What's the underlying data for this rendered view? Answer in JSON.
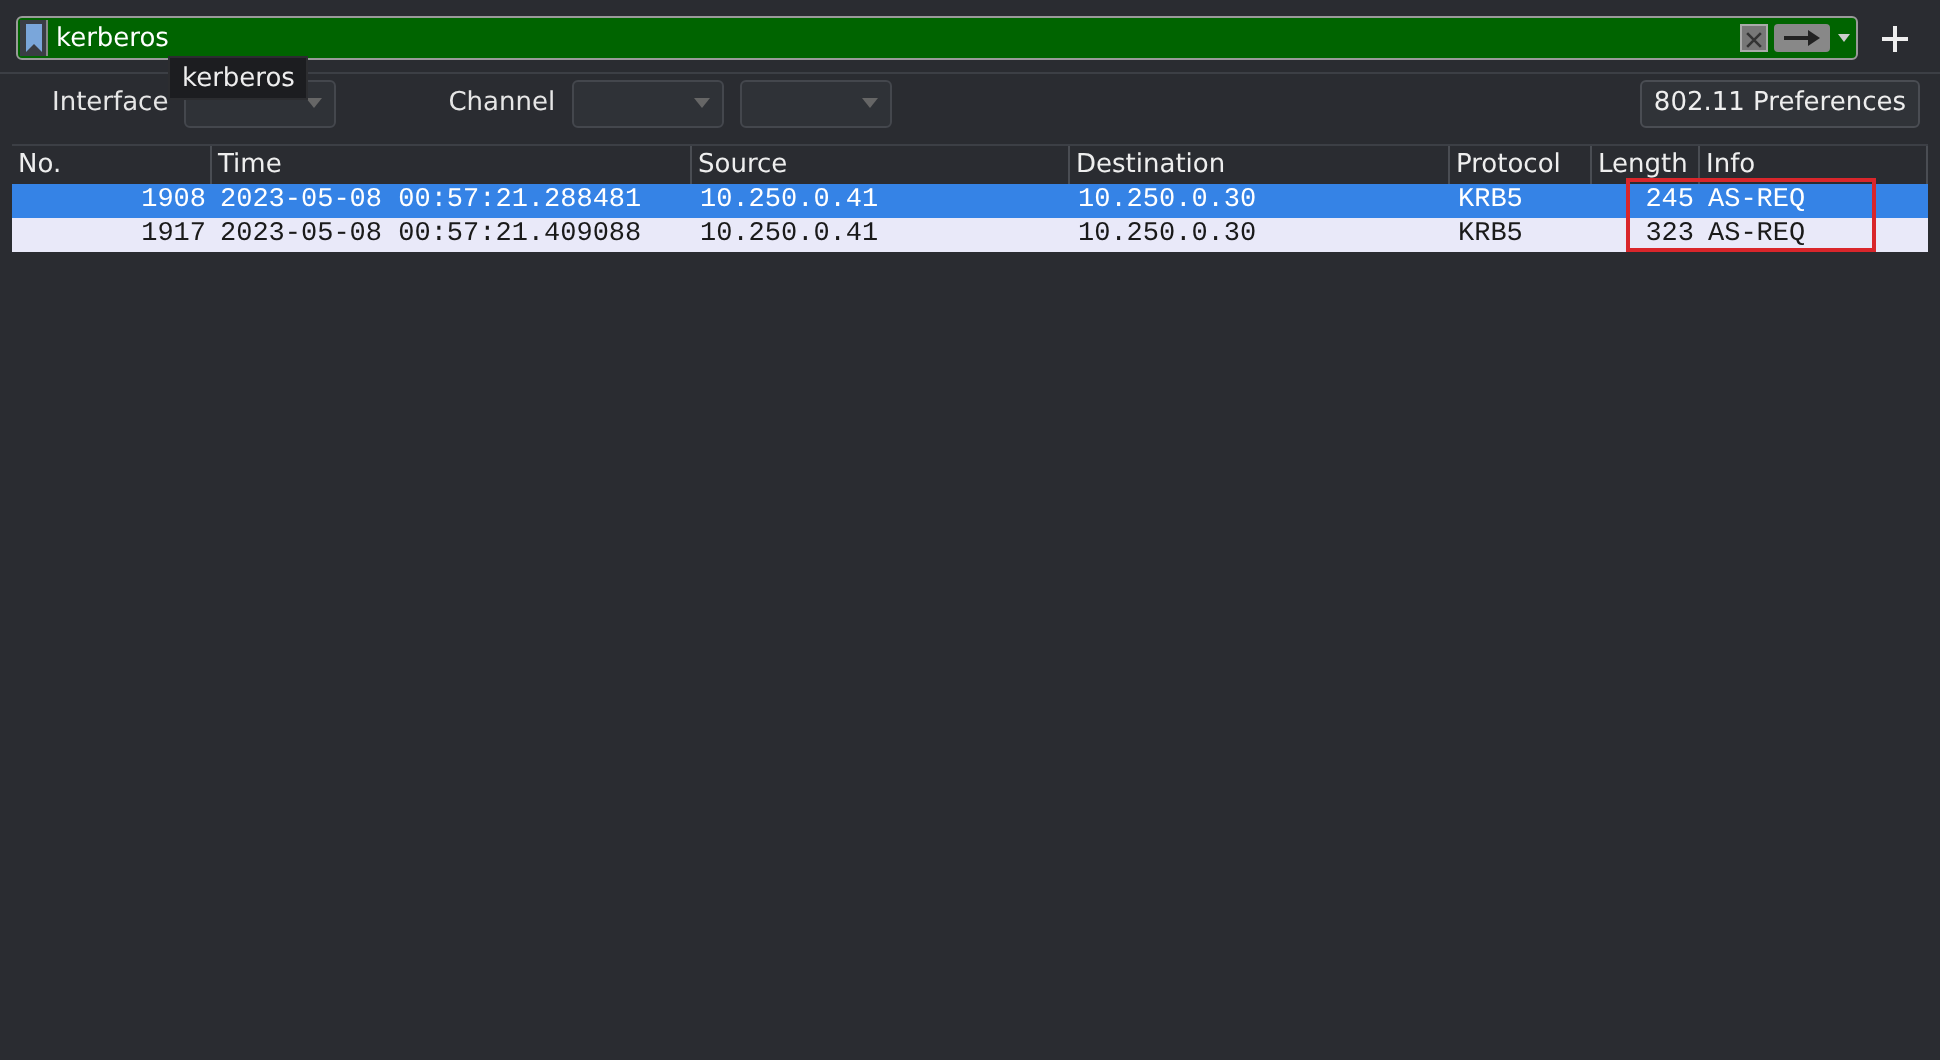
{
  "filter": {
    "value": "kerberos"
  },
  "tooltip": {
    "text": "kerberos"
  },
  "toolbar": {
    "interface_label": "Interface",
    "channel_label": "Channel",
    "preferences_button": "802.11 Preferences"
  },
  "table": {
    "columns": [
      "No.",
      "Time",
      "Source",
      "Destination",
      "Protocol",
      "Length",
      "Info"
    ],
    "rows": [
      {
        "selected": true,
        "cells": [
          "1908",
          "2023-05-08 00:57:21.288481",
          "10.250.0.41",
          "10.250.0.30",
          "KRB5",
          "245",
          "AS-REQ"
        ]
      },
      {
        "selected": false,
        "cells": [
          "1917",
          "2023-05-08 00:57:21.409088",
          "10.250.0.41",
          "10.250.0.30",
          "KRB5",
          "323",
          "AS-REQ"
        ]
      }
    ]
  }
}
